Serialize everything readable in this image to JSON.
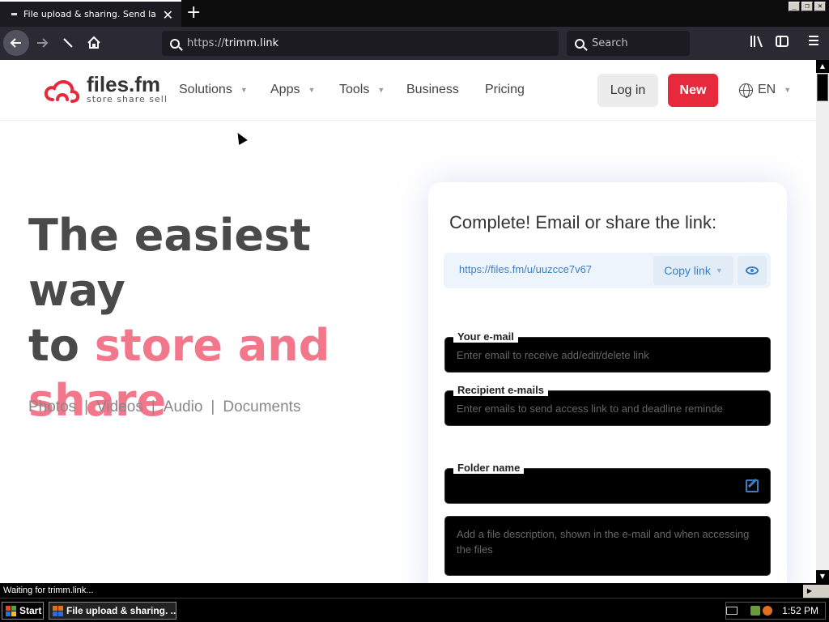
{
  "browser": {
    "tab_title": "File upload & sharing. Send large p",
    "new_tab": "+",
    "url_proto": "https://",
    "url_host": "trimm.link",
    "search_placeholder": "Search",
    "status_text": "Waiting for trimm.link..."
  },
  "site": {
    "logo_main": "files.fm",
    "logo_sub": "store share sell",
    "menu": [
      "Solutions",
      "Apps",
      "Tools",
      "Business",
      "Pricing"
    ],
    "login": "Log in",
    "new": "New",
    "lang": "EN",
    "brand_color": "#e8283c"
  },
  "hero": {
    "line1": "The easiest way",
    "line2_plain": "to ",
    "line2_pink": "store and",
    "line3_pink": "share",
    "categories": [
      "Photos",
      "Videos",
      "Audio",
      "Documents"
    ],
    "separator": "|"
  },
  "card": {
    "title": "Complete! Email or share the link:",
    "share_link": "https://files.fm/u/uuzcce7v67",
    "copy_label": "Copy link",
    "email_label": "Your e-mail",
    "email_placeholder": "Enter email to receive add/edit/delete link",
    "recipient_label": "Recipient e-mails",
    "recipient_placeholder": "Enter emails to send access link to and deadline reminde",
    "folder_label": "Folder name",
    "folder_value": "",
    "description_placeholder": "Add a file description, shown in the e-mail and when accessing the files"
  },
  "taskbar": {
    "start": "Start",
    "task": "File upload & sharing. ...",
    "clock": "1:52 PM"
  }
}
